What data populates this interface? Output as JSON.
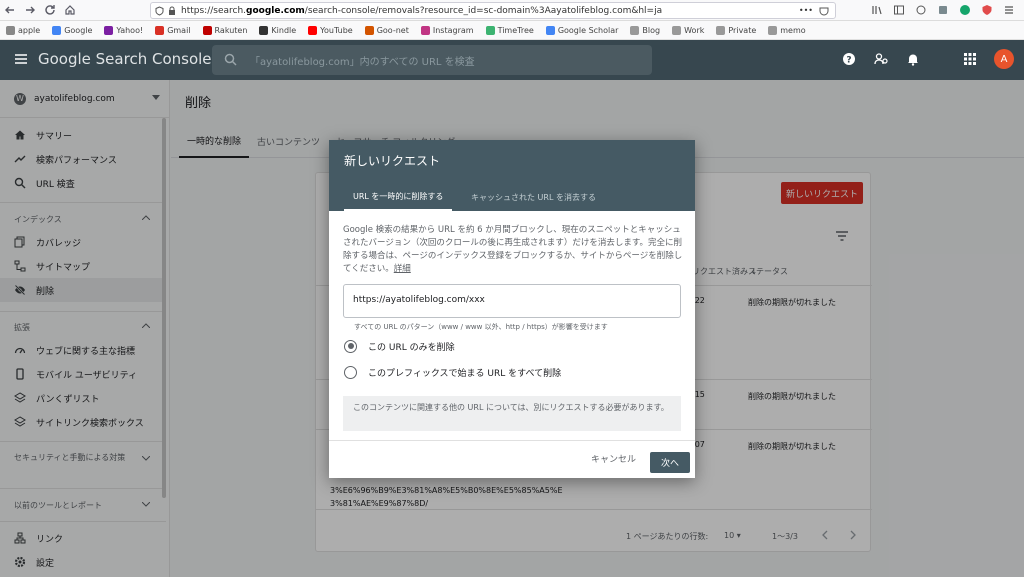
{
  "browser": {
    "url_prefix": "https://search.",
    "url_host": "google.com",
    "url_rest": "/search-console/removals?resource_id=sc-domain%3Aayatolifeblog.com&hl=ja",
    "more": "•••"
  },
  "bookmarks": [
    "apple",
    "Google",
    "Yahoo!",
    "Gmail",
    "Rakuten",
    "Kindle",
    "YouTube",
    "Goo-net",
    "Instagram",
    "TimeTree",
    "Google Scholar",
    "Blog",
    "Work",
    "Private",
    "memo"
  ],
  "header": {
    "app_title": "Google Search Console",
    "search_placeholder": "「ayatolifeblog.com」内のすべての URL を検査",
    "avatar_letter": "A"
  },
  "sidebar": {
    "property": "ayatolifeblog.com",
    "items_top": [
      "サマリー",
      "検索パフォーマンス",
      "URL 検査"
    ],
    "section_index": "インデックス",
    "items_index": [
      "カバレッジ",
      "サイトマップ",
      "削除"
    ],
    "section_ext": "拡張",
    "items_ext": [
      "ウェブに関する主な指標",
      "モバイル ユーザビリティ",
      "パンくずリスト",
      "サイトリンク検索ボックス"
    ],
    "section_security": "セキュリティと手動による対策",
    "section_legacy": "以前のツールとレポート",
    "items_bottom": [
      "リンク",
      "設定"
    ]
  },
  "main": {
    "page_title": "削除",
    "tabs": [
      "一時的な削除",
      "古いコンテンツ",
      "セーフサーチ フィルタリング"
    ],
    "new_request_button": "新しいリクエスト",
    "col_date": "リクエスト済み",
    "col_status": "ステータス",
    "rows": [
      {
        "date": "/22",
        "status": "削除の期限が切れました"
      },
      {
        "date": "/15",
        "status": "削除の期限が切れました"
      },
      {
        "date": "/07",
        "status": "削除の期限が切れました"
      }
    ],
    "long_url_line1": "3%E6%96%B9%E3%81%A8%E5%B0%8E%E5%85%A5%E",
    "long_url_line2": "3%81%AE%E9%87%8D/",
    "rows_per_page_label": "1 ページあたりの行数:",
    "rows_per_page": "10",
    "range": "1〜3/3"
  },
  "dialog": {
    "title": "新しいリクエスト",
    "tab_active": "URL を一時的に削除する",
    "tab_inactive": "キャッシュされた URL を消去する",
    "description": "Google 検索の結果から URL を約 6 か月間ブロックし、現在のスニペットとキャッシュされたバージョン（次回のクロールの後に再生成されます）だけを消去します。完全に削除する場合は、ページのインデックス登録をブロックするか、サイトからページを削除してください。",
    "details_link": "詳細",
    "url_value": "https://ayatolifeblog.com/xxx",
    "hint": "すべての URL のパターン（www / www 以外、http / https）が影響を受けます",
    "radio1": "この URL のみを削除",
    "radio2": "このプレフィックスで始まる URL をすべて削除",
    "note": "このコンテンツに関連する他の URL については、別にリクエストする必要があります。",
    "cancel": "キャンセル",
    "next": "次へ"
  },
  "colors": {
    "header_bg": "#37474f",
    "dialog_header": "#455a64",
    "new_request_red": "#d93025",
    "avatar": "#e8542c"
  }
}
